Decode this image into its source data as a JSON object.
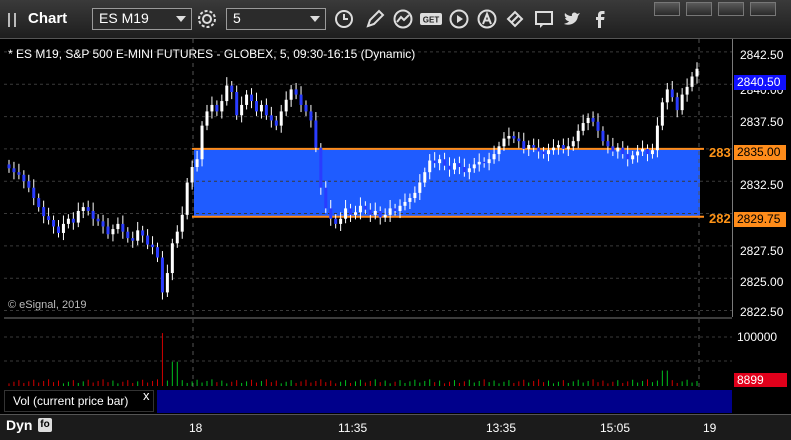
{
  "toolbar": {
    "title": "Chart",
    "symbol": "ES M19",
    "interval": "5",
    "icons": [
      "refresh-gear-icon",
      "clock-icon",
      "pencil-icon",
      "chart-study-icon",
      "get-icon",
      "play-icon",
      "alert-icon",
      "link-icon",
      "chat-icon",
      "twitter-icon",
      "facebook-icon"
    ]
  },
  "chart": {
    "title": "* ES M19, S&P 500 E-MINI FUTURES - GLOBEX, 5, 09:30-16:15 (Dynamic)",
    "watermark": "© eSignal, 2019",
    "price_ticks": [
      "2842.50",
      "2840.00",
      "2837.50",
      "2835.00",
      "2832.50",
      "2830.00",
      "2827.50",
      "2825.00",
      "2822.50"
    ],
    "last_price": "2840.50",
    "upper_line_tag": "2835.00",
    "lower_line_tag": "2829.75",
    "upper_line_label": "283",
    "lower_line_label": "282"
  },
  "volume": {
    "legend": "Vol (current price bar)",
    "close_symbol": "x",
    "axis_label": "100000",
    "last_volume": "8899"
  },
  "bottom": {
    "mode": "Dyn",
    "mode_icon": "fo",
    "time_labels": [
      "18",
      "11:35",
      "13:35",
      "15:05",
      "19"
    ]
  },
  "colors": {
    "up_candle": "#ffffff",
    "down_candle": "#2a3cff",
    "band_fill": "#1f5cff",
    "level_line": "#ff8c1a",
    "volume_up": "#00c020",
    "volume_down": "#d00000"
  },
  "chart_data": {
    "type": "candlestick",
    "title": "* ES M19, S&P 500 E-MINI FUTURES - GLOBEX, 5, 09:30-16:15 (Dynamic)",
    "ylim": [
      2822.0,
      2843.5
    ],
    "y_ticks": [
      2842.5,
      2840.0,
      2837.5,
      2835.0,
      2832.5,
      2830.0,
      2827.5,
      2825.0,
      2822.5
    ],
    "x_ticks": [
      "18",
      "11:35",
      "13:35",
      "15:05",
      "19"
    ],
    "horizontal_levels": [
      2835.0,
      2829.75
    ],
    "band": {
      "from": 2829.75,
      "to": 2835.0
    },
    "last_price": 2840.5,
    "candles_close": [
      2833.5,
      2833.2,
      2833.0,
      2832.5,
      2832.0,
      2831.2,
      2830.5,
      2829.8,
      2829.5,
      2829.0,
      2828.5,
      2829.2,
      2829.6,
      2829.3,
      2830.2,
      2830.5,
      2830.2,
      2829.6,
      2829.4,
      2829.0,
      2828.4,
      2828.8,
      2829.2,
      2828.6,
      2828.1,
      2827.9,
      2828.7,
      2828.3,
      2827.6,
      2827.4,
      2826.6,
      2823.9,
      2825.4,
      2827.7,
      2828.6,
      2829.9,
      2832.4,
      2833.6,
      2834.2,
      2836.8,
      2837.9,
      2838.4,
      2837.9,
      2838.7,
      2839.9,
      2839.4,
      2837.6,
      2838.4,
      2839.2,
      2838.7,
      2837.9,
      2838.4,
      2837.6,
      2837.2,
      2836.8,
      2837.9,
      2838.8,
      2839.6,
      2839.2,
      2838.4,
      2837.9,
      2837.2,
      2835.1,
      2832.0,
      2830.4,
      2829.6,
      2829.2,
      2829.6,
      2830.4,
      2829.9,
      2830.1,
      2830.6,
      2830.3,
      2829.9,
      2830.2,
      2829.7,
      2829.9,
      2830.4,
      2830.2,
      2830.6,
      2830.9,
      2831.2,
      2831.6,
      2832.4,
      2833.2,
      2834.1,
      2833.9,
      2834.2,
      2833.7,
      2833.4,
      2833.9,
      2833.6,
      2833.2,
      2833.5,
      2833.8,
      2834.0,
      2833.9,
      2834.2,
      2834.6,
      2835.2,
      2835.8,
      2836.0,
      2835.8,
      2835.6,
      2835.0,
      2835.3,
      2835.1,
      2834.8,
      2834.6,
      2834.9,
      2835.1,
      2835.3,
      2835.0,
      2835.2,
      2835.6,
      2836.4,
      2837.0,
      2837.4,
      2837.1,
      2836.4,
      2835.6,
      2835.2,
      2834.8,
      2835.1,
      2834.6,
      2834.2,
      2834.5,
      2834.8,
      2835.0,
      2834.6,
      2834.9,
      2836.8,
      2838.6,
      2839.6,
      2839.0,
      2838.0,
      2839.2,
      2839.8,
      2840.6,
      2841.2
    ],
    "volume_max": 100000,
    "last_volume": 8899
  }
}
